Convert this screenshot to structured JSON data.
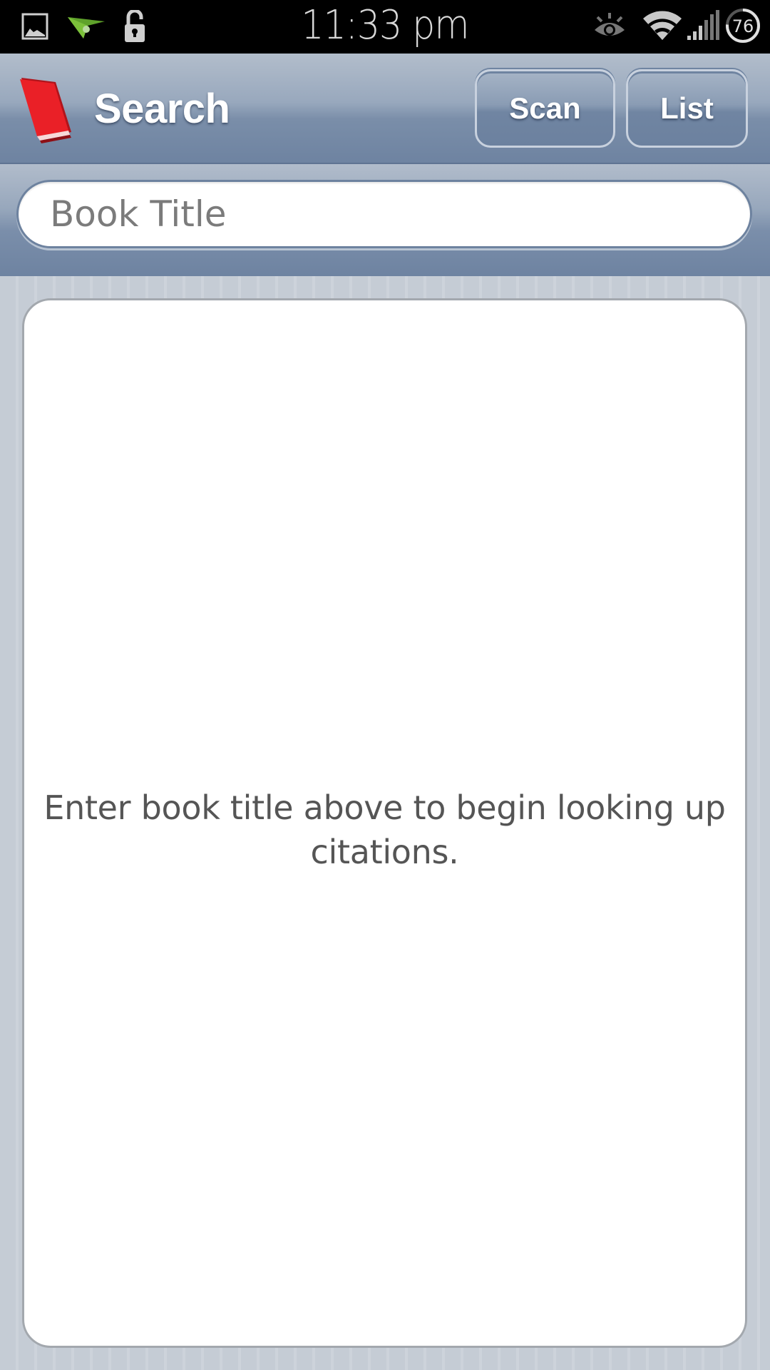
{
  "status_bar": {
    "time": "11:33 pm",
    "battery_level": "76",
    "left_icons": [
      "gallery-icon",
      "airdroid-icon",
      "lock-open-icon"
    ],
    "right_icons": [
      "eye-icon",
      "wifi-icon",
      "signal-icon",
      "battery-icon"
    ]
  },
  "header": {
    "logo_icon": "red-book-icon",
    "title": "Search",
    "scan_label": "Scan",
    "list_label": "List"
  },
  "search": {
    "placeholder": "Book Title",
    "value": ""
  },
  "content": {
    "empty_message": "Enter book title above to begin looking up citations."
  },
  "colors": {
    "header_blue": "#6e83a1",
    "logo_red": "#e8202a",
    "message_text": "#555555"
  }
}
